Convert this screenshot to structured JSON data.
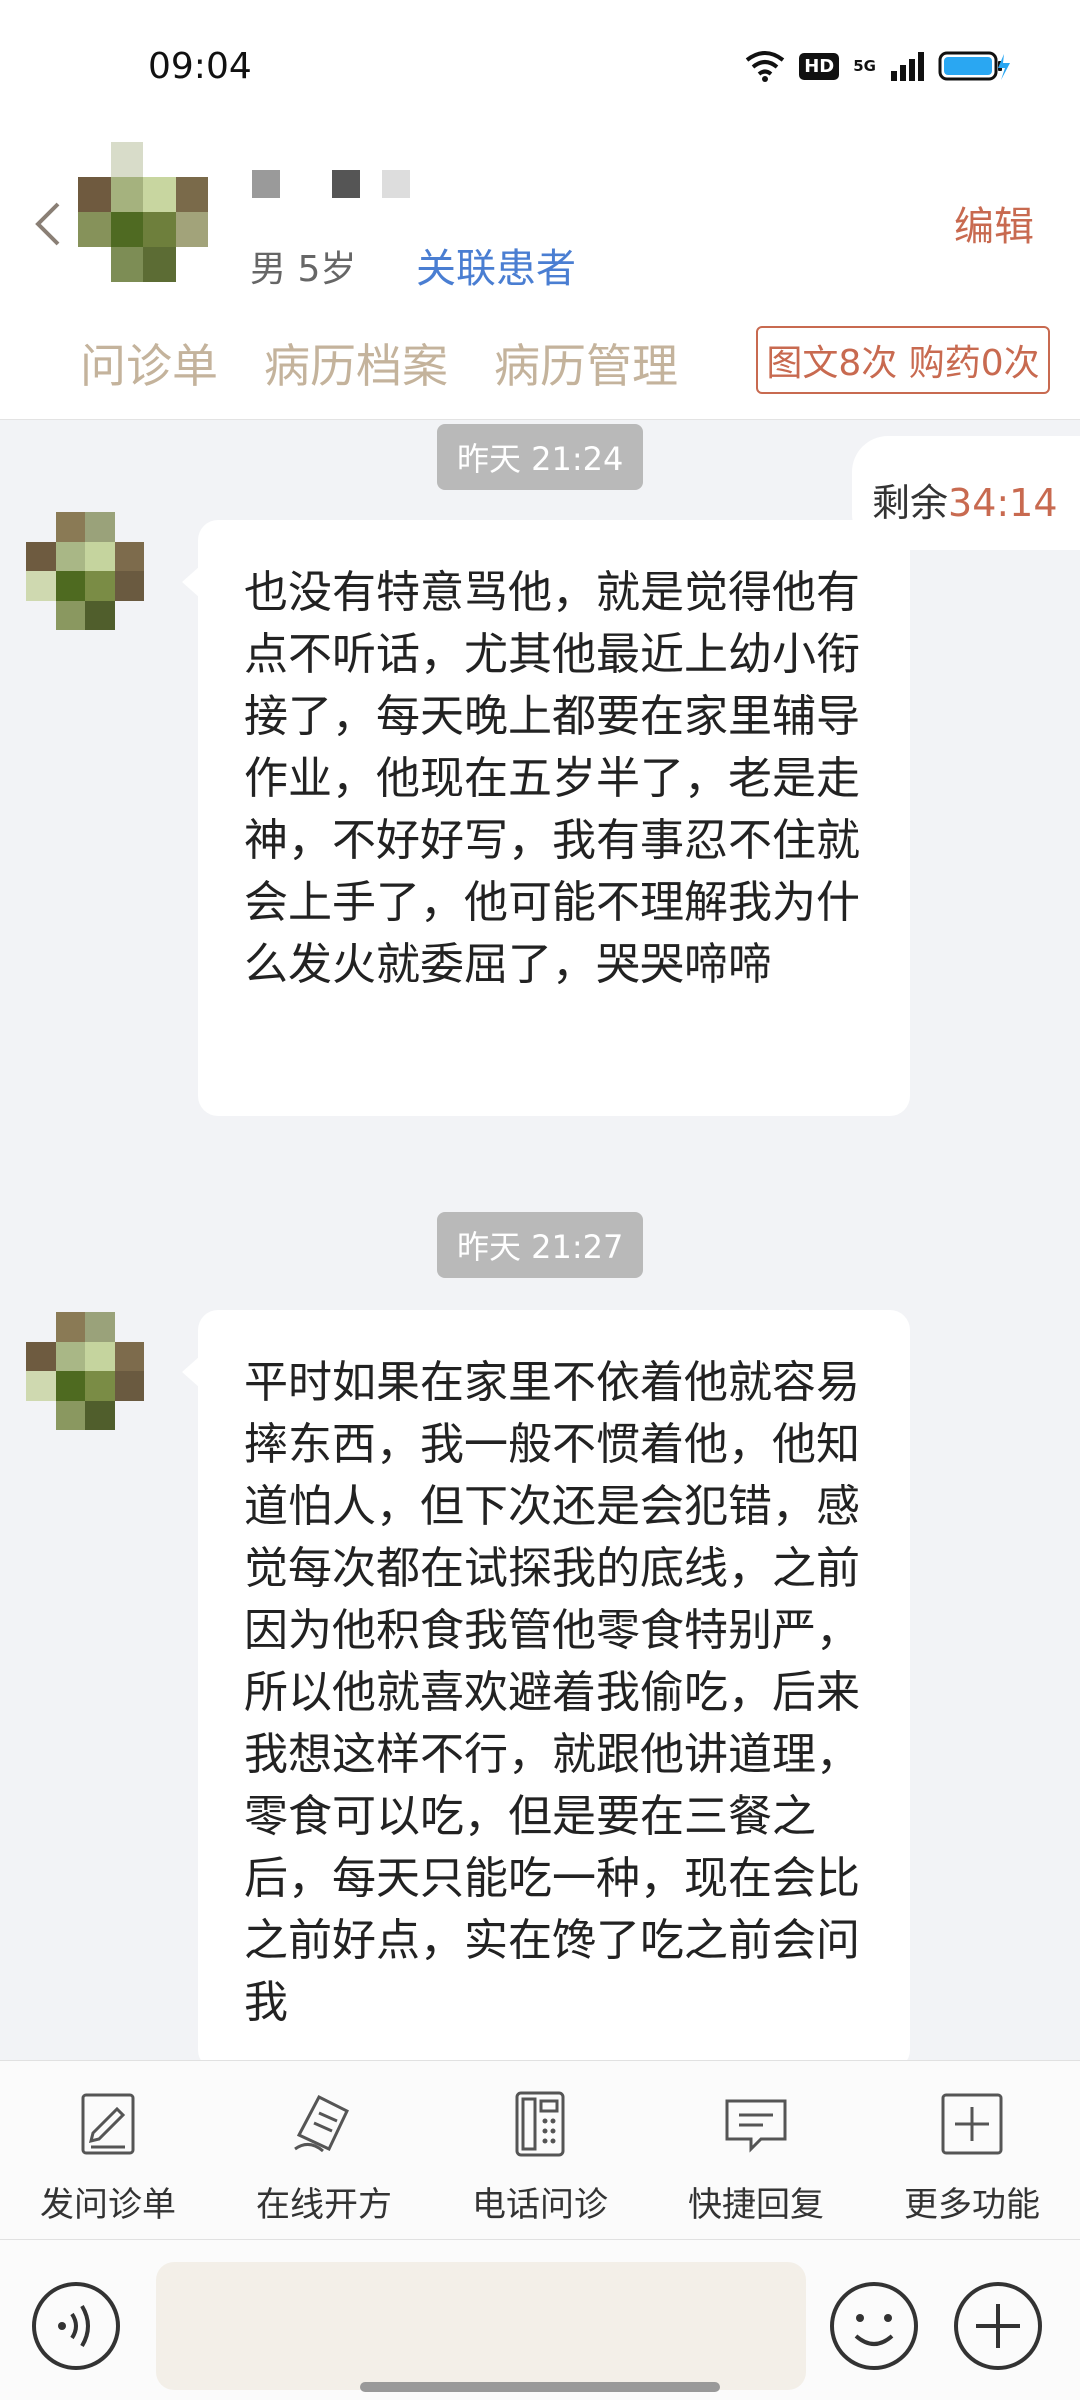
{
  "status_bar": {
    "time": "09:04",
    "hd": "HD",
    "network": "5G"
  },
  "header": {
    "gender_age": "男 5岁",
    "link_label": "关联患者",
    "edit_label": "编辑",
    "tabs": [
      "问诊单",
      "病历档案",
      "病历管理"
    ],
    "count_badge": "图文8次 购药0次"
  },
  "chat": {
    "remaining_label": "剩余",
    "remaining_time": "34:14",
    "messages": [
      {
        "time": "昨天 21:24",
        "text": "也没有特意骂他，就是觉得他有点不听话，尤其他最近上幼小衔接了，每天晚上都要在家里辅导作业，他现在五岁半了，老是走神，不好好写，我有事忍不住就会上手了，他可能不理解我为什么发火就委屈了，哭哭啼啼"
      },
      {
        "time": "昨天 21:27",
        "text": "平时如果在家里不依着他就容易摔东西，我一般不惯着他，他知道怕人，但下次还是会犯错，感觉每次都在试探我的底线，之前因为他积食我管他零食特别严，所以他就喜欢避着我偷吃，后来我想这样不行，就跟他讲道理，零食可以吃，但是要在三餐之后，每天只能吃一种，现在会比之前好点，实在馋了吃之前会问我"
      }
    ]
  },
  "toolbar": {
    "items": [
      {
        "label": "发问诊单",
        "icon": "form-edit-icon"
      },
      {
        "label": "在线开方",
        "icon": "prescription-icon"
      },
      {
        "label": "电话问诊",
        "icon": "phone-consult-icon"
      },
      {
        "label": "快捷回复",
        "icon": "quick-reply-icon"
      },
      {
        "label": "更多功能",
        "icon": "more-functions-icon"
      }
    ]
  },
  "input": {
    "placeholder": ""
  },
  "colors": {
    "accent": "#c86a50",
    "link": "#4a7ed2",
    "tab": "#c4b39c"
  }
}
